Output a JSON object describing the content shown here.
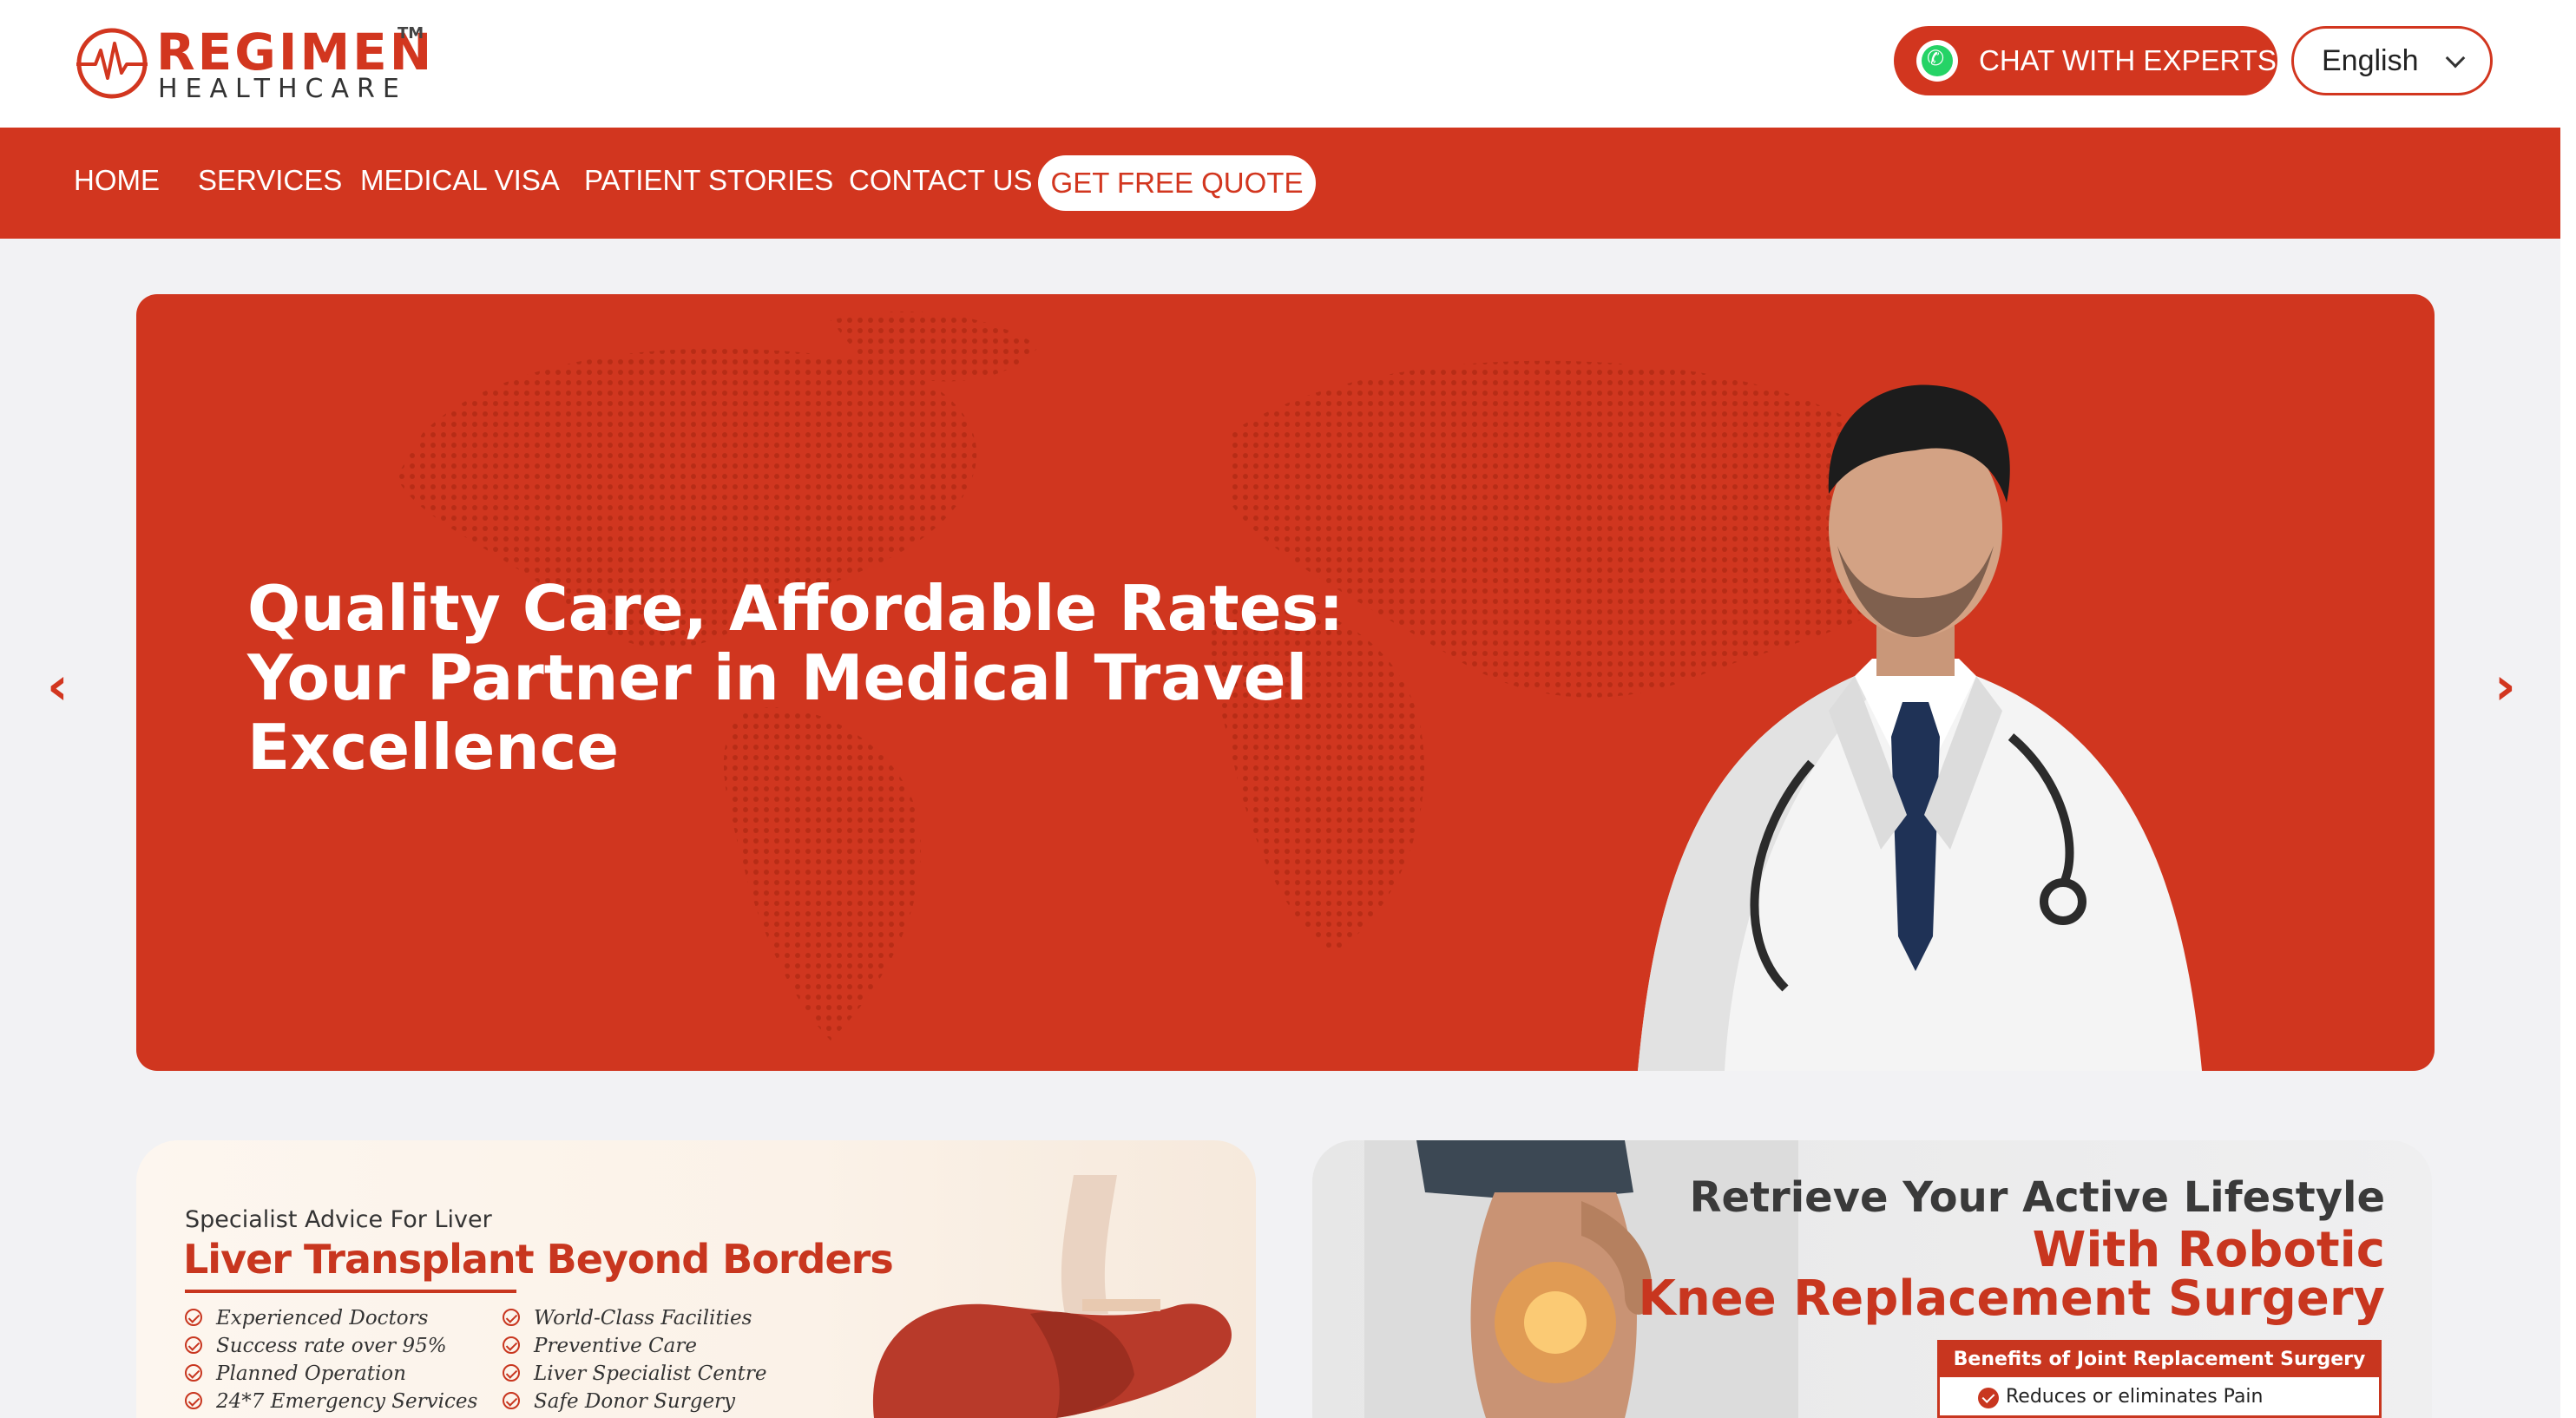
{
  "brand": {
    "name": "REGIMEN",
    "trademark": "TM",
    "subtitle": "HEALTHCARE",
    "accent": "#d2361f"
  },
  "header": {
    "chat_label": "CHAT WITH EXPERTS",
    "chat_icon": "whatsapp-icon",
    "language": "English"
  },
  "nav": {
    "items": [
      "HOME",
      "SERVICES",
      "MEDICAL VISA",
      "PATIENT STORIES",
      "CONTACT US"
    ],
    "cta": "GET FREE QUOTE"
  },
  "hero": {
    "title_line1": "Quality Care, Affordable Rates:",
    "title_line2": "Your Partner in Medical Travel",
    "title_line3": "Excellence",
    "prev_arrow": "‹",
    "next_arrow": "›"
  },
  "promo_liver": {
    "kicker": "Specialist Advice For Liver",
    "title": "Liver Transplant Beyond Borders",
    "features_left": [
      "Experienced Doctors",
      "Success rate over 95%",
      "Planned Operation",
      "24*7 Emergency Services"
    ],
    "features_right": [
      "World-Class Facilities",
      "Preventive Care",
      "Liver Specialist Centre",
      "Safe Donor Surgery"
    ]
  },
  "promo_knee": {
    "line1": "Retrieve Your Active Lifestyle",
    "line2": "With Robotic",
    "line3": "Knee Replacement Surgery",
    "benefits_title": "Benefits of Joint Replacement Surgery",
    "benefit_1": "Reduces or eliminates Pain"
  }
}
